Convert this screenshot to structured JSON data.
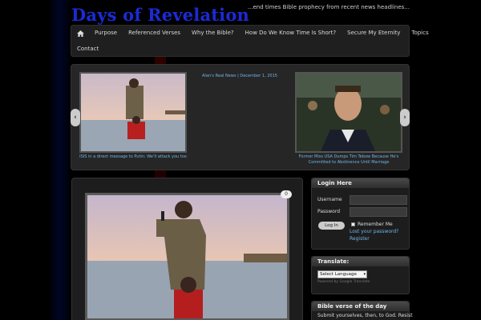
{
  "site": {
    "title": "Days of Revelation",
    "tagline": "...end times Bible prophecy from recent news headlines..."
  },
  "nav": {
    "row1": [
      "Purpose",
      "Referenced Verses",
      "Why the Bible?",
      "How Do We Know Time Is Short?",
      "Secure My Eternity",
      "Topics"
    ],
    "row2": [
      "Contact"
    ]
  },
  "slider": {
    "center_meta": "Alan's Real News | December 1, 2015",
    "left_caption": "ISIS in a direct message to Putin: We'll attack you too",
    "right_caption": "Former Miss USA Dumps Tim Tebow Because He's Committed to Abstinence Until Marriage"
  },
  "post": {
    "comment_count": "0"
  },
  "login": {
    "heading": "Login Here",
    "username_label": "Username",
    "password_label": "Password",
    "login_button": "Log In",
    "remember_label": "Remember Me",
    "lost_password": "Lost your password?",
    "register": "Register"
  },
  "translate": {
    "heading": "Translate:",
    "select_value": "Select Language",
    "powered_by": "Powered by Google Translate"
  },
  "verse": {
    "heading": "Bible verse of the day",
    "text": "Submit yourselves, then, to God. Resist"
  },
  "colors": {
    "title": "#1a2bd6",
    "link": "#6fb6e8",
    "background": "#000000"
  }
}
